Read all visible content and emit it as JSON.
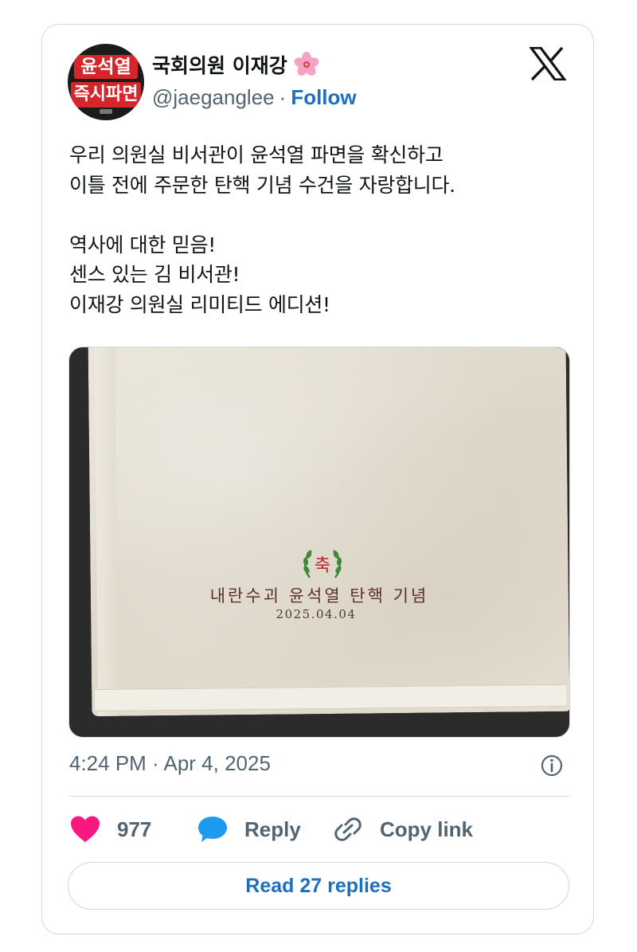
{
  "author": {
    "avatar_line1": "윤석열",
    "avatar_line2": "즉시파면",
    "display_name": "국회의원 이재강",
    "name_emoji": "hibiscus-icon",
    "handle": "@jaeganglee",
    "separator": "·",
    "follow_label": "Follow"
  },
  "platform_icon": "x-logo-icon",
  "tweet": {
    "lines": [
      "우리 의원실 비서관이 윤석열 파면을 확신하고",
      "이틀 전에 주문한 탄핵 기념 수건을 자랑합니다.",
      "",
      "역사에 대한 믿음!",
      "센스 있는 김 비서관!",
      "이재강 의원실 리미티드 에디션!"
    ]
  },
  "media": {
    "emblem_char": "축",
    "embroidery_line1": "내란수괴 윤석열 탄핵 기념",
    "embroidery_line2": "2025.04.04"
  },
  "meta": {
    "timestamp": "4:24 PM · Apr 4, 2025",
    "info_icon": "info-icon"
  },
  "actions": {
    "like_count": "977",
    "reply_label": "Reply",
    "copy_link_label": "Copy link"
  },
  "read_replies_label": "Read 27 replies",
  "colors": {
    "accent": "#1d6fc0",
    "like": "#f91880",
    "reply_icon": "#1d9bf0",
    "muted": "#536471",
    "border": "#cfd9de"
  }
}
